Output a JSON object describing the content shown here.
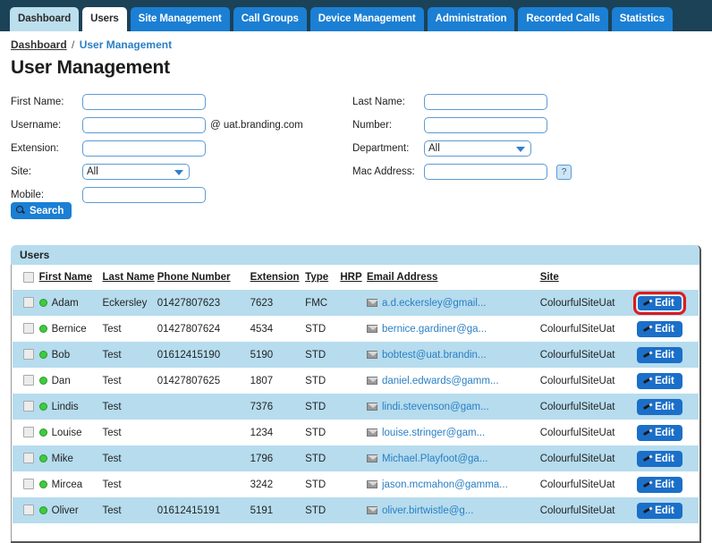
{
  "nav": {
    "tabs": [
      {
        "label": "Dashboard",
        "state": "hovered"
      },
      {
        "label": "Users",
        "state": "active"
      },
      {
        "label": "Site Management",
        "state": "normal"
      },
      {
        "label": "Call Groups",
        "state": "normal"
      },
      {
        "label": "Device Management",
        "state": "normal"
      },
      {
        "label": "Administration",
        "state": "normal"
      },
      {
        "label": "Recorded Calls",
        "state": "normal"
      },
      {
        "label": "Statistics",
        "state": "normal"
      }
    ]
  },
  "breadcrumb": {
    "root": "Dashboard",
    "separator": "/",
    "current": "User Management"
  },
  "page": {
    "title": "User Management"
  },
  "search_form": {
    "first_name": {
      "label": "First Name:",
      "value": "",
      "placeholder": ""
    },
    "username": {
      "label": "Username:",
      "value": "",
      "placeholder": "",
      "suffix": "@ uat.branding.com"
    },
    "extension": {
      "label": "Extension:",
      "value": "",
      "placeholder": ""
    },
    "site": {
      "label": "Site:",
      "value": "All"
    },
    "mobile": {
      "label": "Mobile:",
      "value": "",
      "placeholder": ""
    },
    "last_name": {
      "label": "Last Name:",
      "value": "",
      "placeholder": ""
    },
    "number": {
      "label": "Number:",
      "value": "",
      "placeholder": ""
    },
    "department": {
      "label": "Department:",
      "value": "All"
    },
    "mac_address": {
      "label": "Mac Address:",
      "value": "",
      "placeholder": "",
      "help_label": "?"
    },
    "search_button": "Search"
  },
  "users_panel": {
    "title": "Users",
    "columns": [
      "First Name",
      "Last Name",
      "Phone Number",
      "Extension",
      "Type",
      "HRP",
      "Email Address",
      "Site"
    ],
    "edit_label": "Edit",
    "rows": [
      {
        "first_name": "Adam",
        "last_name": "Eckersley",
        "phone_number": "01427807623",
        "extension": "7623",
        "type": "FMC",
        "hrp": "",
        "email": "a.d.eckersley@gmail...",
        "site": "ColourfulSiteUat",
        "status": "online",
        "edit_highlighted": true
      },
      {
        "first_name": "Bernice",
        "last_name": "Test",
        "phone_number": "01427807624",
        "extension": "4534",
        "type": "STD",
        "hrp": "",
        "email": "bernice.gardiner@ga...",
        "site": "ColourfulSiteUat",
        "status": "online",
        "edit_highlighted": false
      },
      {
        "first_name": "Bob",
        "last_name": "Test",
        "phone_number": "01612415190",
        "extension": "5190",
        "type": "STD",
        "hrp": "",
        "email": "bobtest@uat.brandin...",
        "site": "ColourfulSiteUat",
        "status": "online",
        "edit_highlighted": false
      },
      {
        "first_name": "Dan",
        "last_name": "Test",
        "phone_number": "01427807625",
        "extension": "1807",
        "type": "STD",
        "hrp": "",
        "email": "daniel.edwards@gamm...",
        "site": "ColourfulSiteUat",
        "status": "online",
        "edit_highlighted": false
      },
      {
        "first_name": "Lindis",
        "last_name": "Test",
        "phone_number": "",
        "extension": "7376",
        "type": "STD",
        "hrp": "",
        "email": "lindi.stevenson@gam...",
        "site": "ColourfulSiteUat",
        "status": "online",
        "edit_highlighted": false
      },
      {
        "first_name": "Louise",
        "last_name": "Test",
        "phone_number": "",
        "extension": "1234",
        "type": "STD",
        "hrp": "",
        "email": "louise.stringer@gam...",
        "site": "ColourfulSiteUat",
        "status": "online",
        "edit_highlighted": false
      },
      {
        "first_name": "Mike",
        "last_name": "Test",
        "phone_number": "",
        "extension": "1796",
        "type": "STD",
        "hrp": "",
        "email": "Michael.Playfoot@ga...",
        "site": "ColourfulSiteUat",
        "status": "online",
        "edit_highlighted": false
      },
      {
        "first_name": "Mircea",
        "last_name": "Test",
        "phone_number": "",
        "extension": "3242",
        "type": "STD",
        "hrp": "",
        "email": "jason.mcmahon@gamma...",
        "site": "ColourfulSiteUat",
        "status": "online",
        "edit_highlighted": false
      },
      {
        "first_name": "Oliver",
        "last_name": "Test",
        "phone_number": "01612415191",
        "extension": "5191",
        "type": "STD",
        "hrp": "",
        "email": "oliver.birtwistle@g...",
        "site": "ColourfulSiteUat",
        "status": "online",
        "edit_highlighted": false
      }
    ]
  },
  "colors": {
    "nav_background": "#1b4257",
    "tab_blue": "#1b7fd4",
    "tab_hovered": "#bcdfee",
    "row_stripe": "#b6dcee",
    "panel_header": "#b6dcee",
    "link_blue": "#2a7fc4",
    "status_green": "#3ecb3e",
    "highlight_red": "#e01b1b",
    "edit_button": "#1b6fc9"
  }
}
